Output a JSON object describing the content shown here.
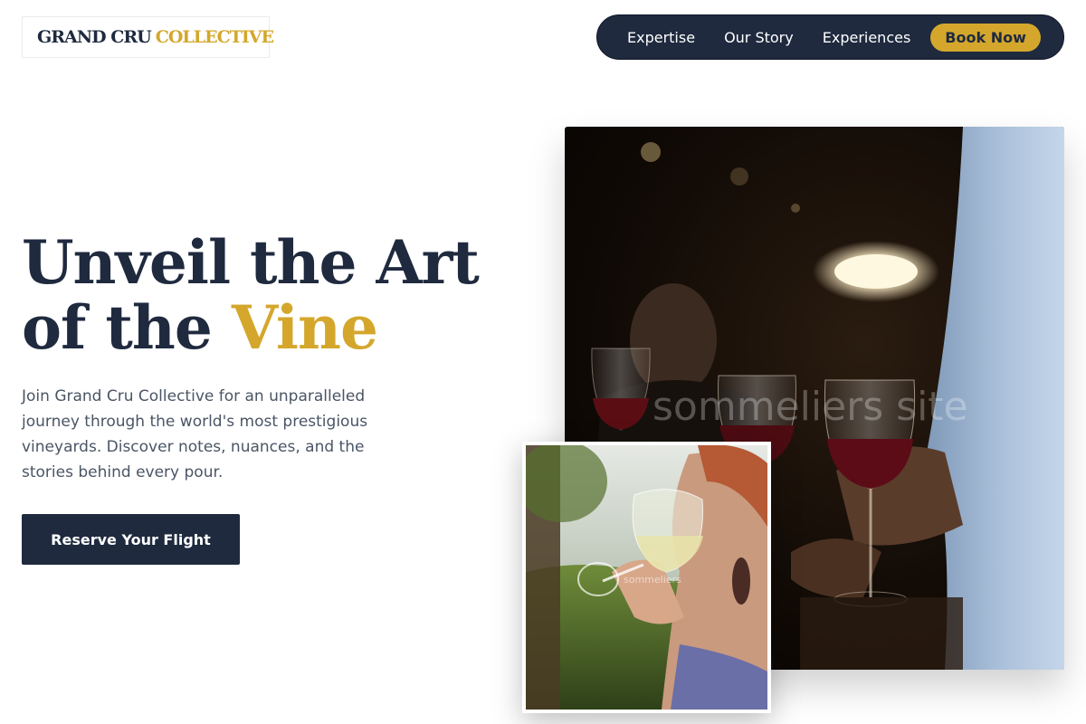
{
  "brand": {
    "name_part1": "GRAND CRU",
    "name_part2": "COLLECTIVE"
  },
  "nav": {
    "items": [
      "Expertise",
      "Our Story",
      "Experiences"
    ],
    "cta_label": "Book Now"
  },
  "hero": {
    "headline_line1": "Unveil the Art",
    "headline_line2_prefix": "of the",
    "headline_accent": "Vine",
    "description": "Join Grand Cru Collective for an unparalleled journey through the world's most prestigious vineyards. Discover notes, nuances, and the stories behind every pour.",
    "cta_label": "Reserve Your Flight"
  },
  "images": {
    "main_watermark": "sommeliers site",
    "inset_watermark": "sommeliers"
  },
  "colors": {
    "navy": "#1f2a3f",
    "gold": "#d4a72c",
    "text_muted": "#4a5565"
  }
}
